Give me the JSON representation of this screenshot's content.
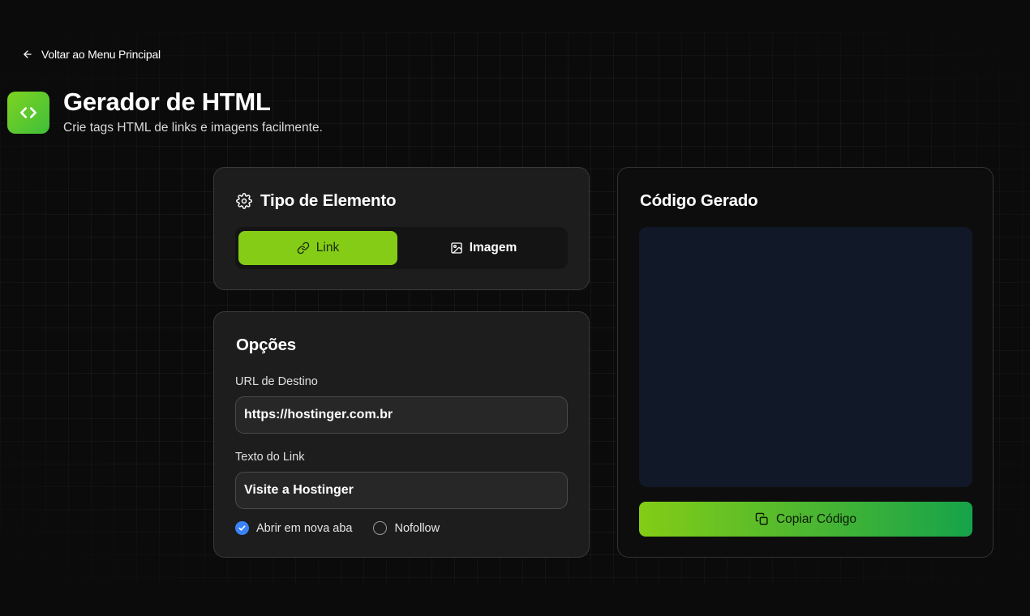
{
  "nav": {
    "back_label": "Voltar ao Menu Principal"
  },
  "header": {
    "title": "Gerador de HTML",
    "subtitle": "Crie tags HTML de links e imagens facilmente.",
    "icon": "code-icon",
    "accent_gradient": [
      "#7ed321",
      "#3fbf3a"
    ]
  },
  "element_type": {
    "heading": "Tipo de Elemento",
    "options": [
      {
        "label": "Link",
        "icon": "link-icon",
        "selected": true
      },
      {
        "label": "Imagem",
        "icon": "image-icon",
        "selected": false
      }
    ]
  },
  "options": {
    "heading": "Opções",
    "url_label": "URL de Destino",
    "url_value": "https://hostinger.com.br",
    "text_label": "Texto do Link",
    "text_value": "Visite a Hostinger",
    "checkboxes": [
      {
        "label": "Abrir em nova aba",
        "checked": true
      },
      {
        "label": "Nofollow",
        "checked": false
      }
    ]
  },
  "output": {
    "heading": "Código Gerado",
    "code": "",
    "copy_label": "Copiar Código"
  },
  "colors": {
    "primary": "#84cc16",
    "checked": "#3b82f6",
    "code_bg": "#111827",
    "card_bg": "#1d1d1d"
  }
}
